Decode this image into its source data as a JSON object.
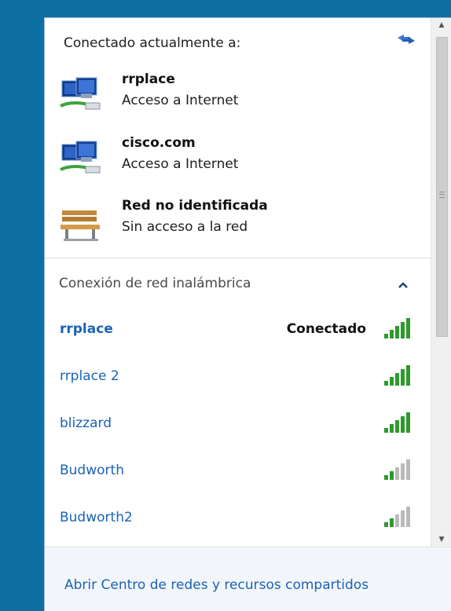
{
  "current": {
    "title": "Conectado actualmente a:",
    "networks": [
      {
        "name": "rrplace",
        "status": "Acceso a Internet",
        "icon": "network-icon"
      },
      {
        "name": "cisco.com",
        "status": "Acceso a Internet",
        "icon": "network-icon"
      },
      {
        "name": "Red no identificada",
        "status": "Sin acceso a la red",
        "icon": "bench-icon"
      }
    ]
  },
  "wireless": {
    "header": "Conexión de red inalámbrica",
    "items": [
      {
        "name": "rrplace",
        "state": "Conectado",
        "signal_bars": 5
      },
      {
        "name": "rrplace 2",
        "state": "",
        "signal_bars": 5
      },
      {
        "name": "blizzard",
        "state": "",
        "signal_bars": 5
      },
      {
        "name": "Budworth",
        "state": "",
        "signal_bars": 2
      },
      {
        "name": "Budworth2",
        "state": "",
        "signal_bars": 2
      }
    ]
  },
  "footer": {
    "link": "Abrir Centro de redes y recursos compartidos"
  },
  "colors": {
    "accent": "#1a62b8",
    "signal_active": "#2e9a2e",
    "signal_inactive": "#b9b9b9",
    "desktop": "#0e6fa3"
  }
}
